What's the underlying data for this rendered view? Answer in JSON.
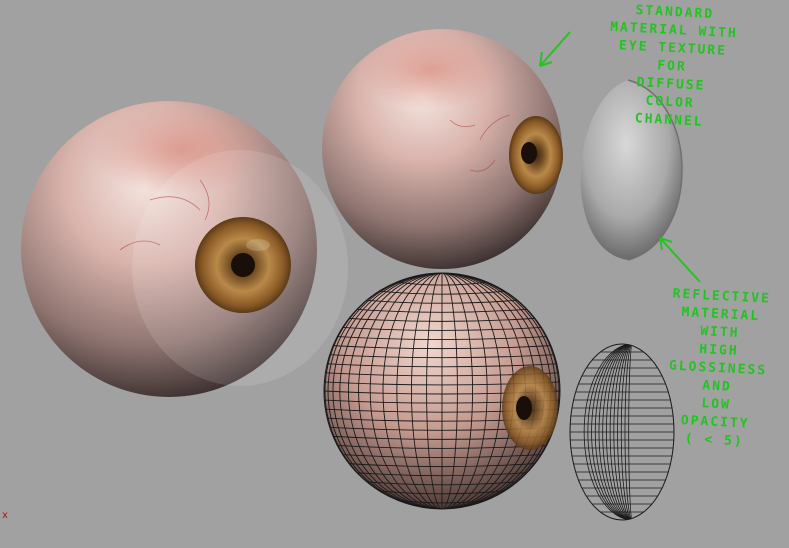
{
  "annotations": {
    "top": "STANDARD\nMATERIAL WITH\nEYE TEXTURE\nFOR\nDIFFUSE\nCOLOR\nCHANNEL",
    "bottom": "REFLECTIVE\nMATERIAL\nWITH\nHIGH\nGLOSSINESS\nAND\nLOW\nOPACITY\n( < 5)"
  },
  "viewport": {
    "axis_label": "x"
  },
  "colors": {
    "background": "#a1a1a1",
    "annotation": "#22c322",
    "wire": "#1a1a1a",
    "iris": "#9b6a30"
  }
}
